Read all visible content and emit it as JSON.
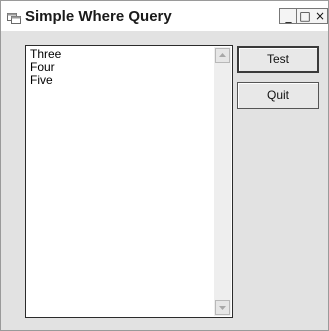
{
  "window": {
    "title": "Simple Where Query",
    "minimize_glyph": "_",
    "maximize_glyph": "□",
    "close_glyph": "×"
  },
  "listbox": {
    "items": [
      "Three",
      "Four",
      "Five"
    ]
  },
  "buttons": {
    "test_label": "Test",
    "quit_label": "Quit"
  },
  "icons": {
    "app": "window-app-icon",
    "scroll_up": "triangle-up-icon",
    "scroll_down": "triangle-down-icon"
  },
  "colors": {
    "window_bg": "#e2e2e2",
    "titlebar_bg": "#ffffff",
    "listbox_bg": "#ffffff"
  }
}
